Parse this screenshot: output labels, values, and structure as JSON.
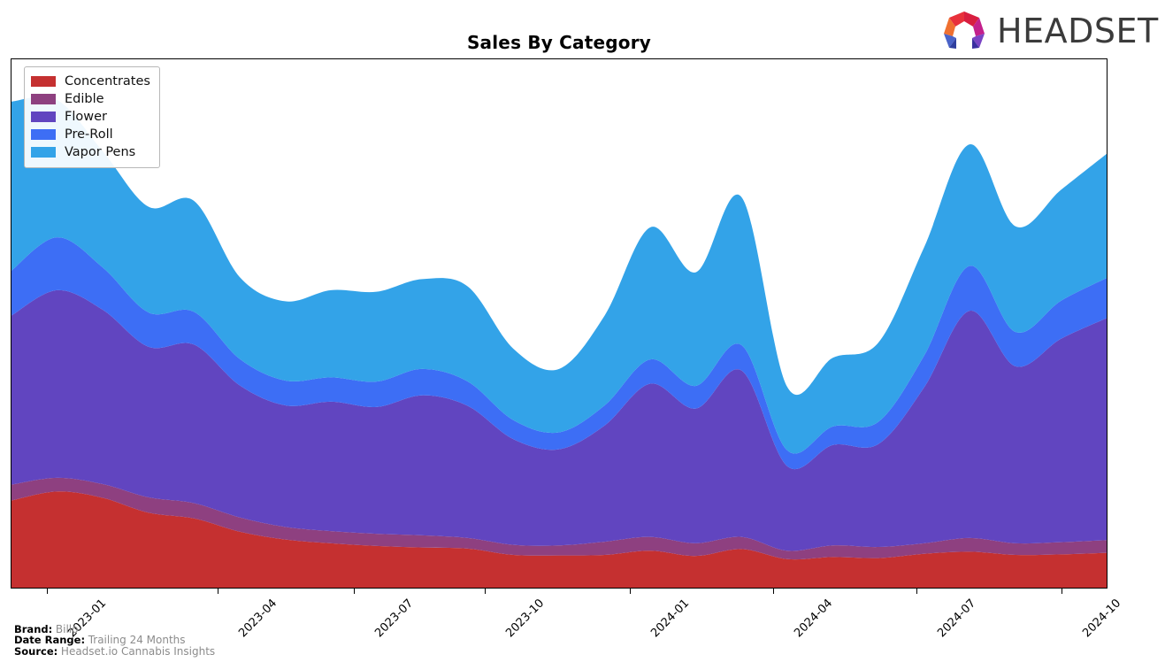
{
  "header": {
    "title": "Sales By Category",
    "logo_text": "HEADSET",
    "logo_icon": "headset-hexagon-logo"
  },
  "legend": {
    "position": "upper-left",
    "items": [
      {
        "label": "Concentrates",
        "color": "#c53030"
      },
      {
        "label": "Edible",
        "color": "#8e4080"
      },
      {
        "label": "Flower",
        "color": "#6145c0"
      },
      {
        "label": "Pre-Roll",
        "color": "#3d6ef5"
      },
      {
        "label": "Vapor Pens",
        "color": "#33a3e8"
      }
    ]
  },
  "footer": {
    "brand_key": "Brand:",
    "brand_value": "Billo",
    "date_range_key": "Date Range:",
    "date_range_value": "Trailing 24 Months",
    "source_key": "Source:",
    "source_value": "Headset.io Cannabis Insights"
  },
  "axis": {
    "x_ticks": [
      "2023-01",
      "2023-04",
      "2023-07",
      "2023-10",
      "2024-01",
      "2024-04",
      "2024-07",
      "2024-10"
    ],
    "x_tick_positions": [
      0.0327,
      0.1887,
      0.3129,
      0.4323,
      0.5645,
      0.6952,
      0.8258,
      0.9581
    ],
    "y_visible": false,
    "grid": false
  },
  "chart_data": {
    "type": "area",
    "stacked": true,
    "title": "Sales By Category",
    "xlabel": "",
    "ylabel": "",
    "smoothing": "spline",
    "x": [
      "2022-11",
      "2022-12",
      "2023-01",
      "2023-02",
      "2023-03",
      "2023-04",
      "2023-05",
      "2023-06",
      "2023-07",
      "2023-08",
      "2023-09",
      "2023-10",
      "2023-11",
      "2023-12",
      "2024-01",
      "2024-02",
      "2024-03",
      "2024-04",
      "2024-05",
      "2024-06",
      "2024-07",
      "2024-08",
      "2024-09",
      "2024-10",
      "2024-11"
    ],
    "ylim": [
      0,
      100
    ],
    "series": [
      {
        "name": "Concentrates",
        "color": "#c53030",
        "values": [
          16.5,
          18.2,
          17.0,
          14.2,
          13.1,
          10.6,
          9.1,
          8.4,
          7.9,
          7.6,
          7.4,
          6.2,
          6.1,
          6.2,
          7.0,
          6.0,
          7.3,
          5.4,
          5.8,
          5.6,
          6.4,
          6.8,
          6.2,
          6.3,
          6.6
        ]
      },
      {
        "name": "Edible",
        "color": "#8e4080",
        "values": [
          3.0,
          2.6,
          2.6,
          2.9,
          2.9,
          2.7,
          2.4,
          2.3,
          2.3,
          2.3,
          2.0,
          1.9,
          1.9,
          2.5,
          2.6,
          2.4,
          2.3,
          1.6,
          2.2,
          2.1,
          2.0,
          2.6,
          2.2,
          2.3,
          2.4
        ]
      },
      {
        "name": "Flower",
        "color": "#6145c0",
        "values": [
          32.0,
          35.5,
          33.0,
          28.5,
          30.0,
          25.0,
          23.0,
          24.5,
          24.0,
          26.5,
          25.0,
          20.0,
          18.2,
          22.0,
          29.0,
          25.5,
          31.5,
          16.0,
          19.0,
          19.5,
          29.5,
          43.0,
          33.5,
          38.5,
          42.0
        ]
      },
      {
        "name": "Pre-Roll",
        "color": "#3d6ef5",
        "values": [
          8.5,
          10.0,
          8.0,
          6.5,
          6.2,
          5.0,
          4.7,
          4.6,
          4.8,
          5.0,
          4.6,
          3.6,
          3.2,
          3.8,
          4.6,
          4.3,
          4.8,
          3.0,
          3.5,
          4.2,
          6.0,
          8.5,
          6.5,
          7.2,
          7.6
        ]
      },
      {
        "name": "Vapor Pens",
        "color": "#33a3e8",
        "values": [
          32.0,
          26.0,
          22.0,
          20.0,
          21.0,
          15.5,
          15.0,
          16.5,
          17.0,
          17.0,
          18.0,
          13.5,
          12.0,
          17.0,
          25.0,
          21.5,
          28.0,
          12.0,
          13.0,
          15.0,
          20.5,
          23.0,
          20.0,
          21.0,
          23.5
        ]
      }
    ]
  }
}
